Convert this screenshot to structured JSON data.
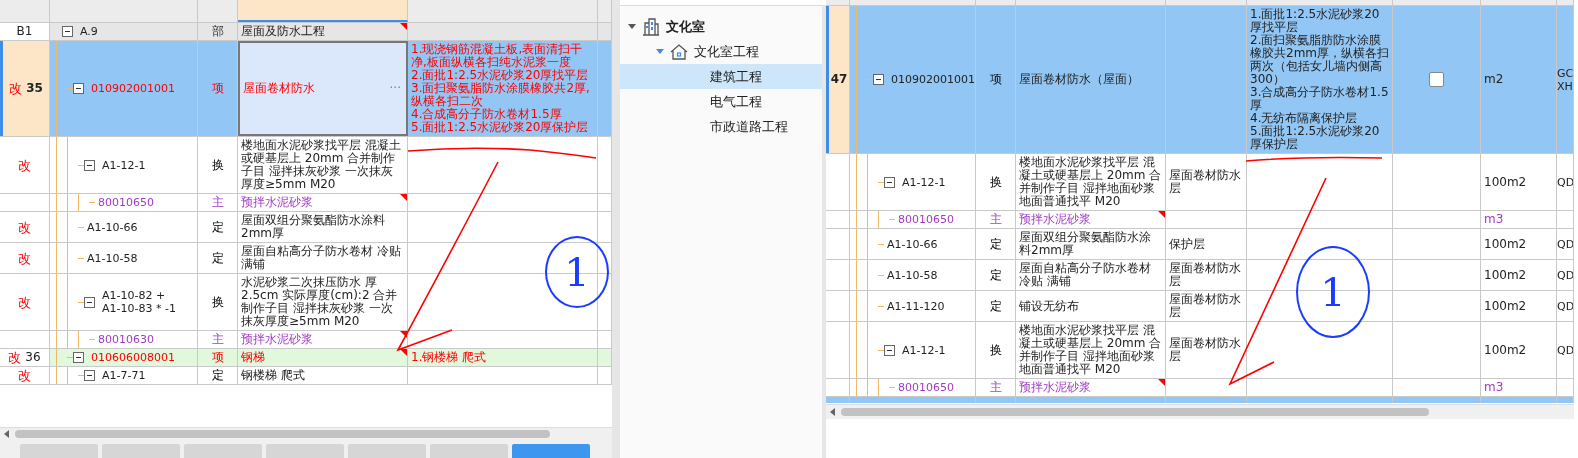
{
  "left_table": {
    "rows": [
      {
        "index": "B1",
        "code": "A.9",
        "type": "部",
        "kind": "section",
        "name": "屋面及防水工程",
        "flagged": true,
        "selected": false,
        "expanded": true,
        "children": [
          {
            "mark": "改",
            "index": "35",
            "code": "010902001001",
            "type": "项",
            "kind": "item",
            "color": "#ff0000",
            "name": "屋面卷材防水",
            "name_button": "···",
            "features": "1.现浇钢筋混凝土板,表面清扫干净,板面纵横各扫纯水泥浆一度\n2.面批1:2.5水泥砂浆20厚找平层\n3.面扫聚氨脂防水涂膜橡胶共2厚,纵横各扫二次\n4.合成高分子防水卷材1.5厚\n5.面批1:2.5水泥砂浆20厚保护层",
            "flagged": false,
            "selected": true,
            "expanded": true,
            "children": [
              {
                "mark": "改",
                "code": "A1-12-1",
                "type": "换",
                "kind": "quota",
                "name": "楼地面水泥砂浆找平层 混凝土或硬基层上 20mm 合并制作子目 湿拌抹灰砂浆 一次抹灰厚度≥5mm M20",
                "flagged": false,
                "selected": false,
                "expanded": true,
                "children": [
                  {
                    "code": "80010650",
                    "type": "主",
                    "kind": "material",
                    "color": "#a23bc4",
                    "name": "预拌水泥砂浆",
                    "flagged": true,
                    "selected": false
                  }
                ]
              },
              {
                "mark": "改",
                "code": "A1-10-66",
                "type": "定",
                "kind": "quota",
                "name": "屋面双组分聚氨酯防水涂料 2mm厚",
                "flagged": false,
                "selected": false
              },
              {
                "mark": "改",
                "code": "A1-10-58",
                "type": "定",
                "kind": "quota",
                "name": "屋面自粘高分子防水卷材 冷贴满铺",
                "flagged": false,
                "selected": false
              },
              {
                "mark": "改",
                "code": "A1-10-82 +\nA1-10-83 * -1",
                "type": "换",
                "kind": "quota",
                "name": "水泥砂浆二次抹压防水 厚2.5cm 实际厚度(cm):2 合并制作子目 湿拌抹灰砂浆 一次抹灰厚度≥5mm M20",
                "flagged": false,
                "selected": false,
                "expanded": true,
                "children": [
                  {
                    "code": "80010630",
                    "type": "主",
                    "kind": "material",
                    "color": "#a23bc4",
                    "name": "预拌水泥砂浆",
                    "flagged": true,
                    "selected": false
                  }
                ]
              }
            ]
          },
          {
            "mark": "改",
            "index": "36",
            "code": "010606008001",
            "type": "项",
            "kind": "item",
            "color": "#ff0000",
            "name": "钢梯",
            "features": "1.钢楼梯 爬式",
            "flagged": true,
            "selected": false,
            "expanded": true,
            "children": [
              {
                "mark": "改",
                "code": "A1-7-71",
                "type": "定",
                "kind": "quota",
                "name": "钢楼梯 爬式",
                "flagged": false,
                "selected": false,
                "expanded": true
              }
            ]
          }
        ]
      }
    ],
    "bottom_tabs": [
      {
        "selected": false
      },
      {
        "selected": false
      },
      {
        "selected": false
      },
      {
        "selected": false
      },
      {
        "selected": false
      },
      {
        "selected": false
      },
      {
        "selected": true
      }
    ],
    "annotations": [
      {
        "kind": "underline"
      },
      {
        "kind": "arrow"
      },
      {
        "kind": "circled",
        "label": "1"
      }
    ]
  },
  "project_tree": [
    {
      "label": "文化室",
      "kind": "project",
      "expanded": true,
      "selected": false,
      "children": [
        {
          "label": "文化室工程",
          "kind": "single",
          "expanded": true,
          "selected": false,
          "children": [
            {
              "label": "建筑工程",
              "kind": "unit",
              "selected": true
            },
            {
              "label": "电气工程",
              "kind": "unit",
              "selected": false
            },
            {
              "label": "市政道路工程",
              "kind": "unit",
              "selected": false
            }
          ]
        }
      ]
    }
  ],
  "right_table": {
    "rows": [
      {
        "index": "47",
        "code": "010902001001",
        "type": "项",
        "kind": "item",
        "name": "屋面卷材防水（屋面）",
        "features": "1.面批1:2.5水泥砂浆20厚找平层\n2.面扫聚氨脂肪防水涂膜橡胶共2mm厚，纵横各扫两次（包括女儿墙内侧高300）\n3.合成高分子防水卷材1.5厚\n4.无纺布隔离保护层\n5.面批1:2.5水泥砂浆20厚保护层",
        "checked": false,
        "unit": "m2",
        "column_9": "GC\nXH",
        "flagged": false,
        "selected": true,
        "expanded": true,
        "children": [
          {
            "code": "A1-12-1",
            "type": "换",
            "kind": "quota",
            "name": "楼地面水泥砂浆找平层 混凝土或硬基层上 20mm 合并制作子目 湿拌地面砂浆地面普通找平 M20",
            "column_5": "屋面卷材防水层",
            "unit": "100m2",
            "column_9": "QD",
            "flagged": false,
            "selected": false,
            "expanded": true,
            "children": [
              {
                "code": "80010650",
                "type": "主",
                "kind": "material",
                "color": "#a23bc4",
                "name": "预拌水泥砂浆",
                "unit": "m3",
                "flagged": true,
                "selected": false
              }
            ]
          },
          {
            "code": "A1-10-66",
            "type": "定",
            "kind": "quota",
            "name": "屋面双组分聚氨酯防水涂料2mm厚",
            "column_5": "保护层",
            "unit": "100m2",
            "column_9": "QD",
            "flagged": false,
            "selected": false
          },
          {
            "code": "A1-10-58",
            "type": "定",
            "kind": "quota",
            "name": "屋面自粘高分子防水卷材冷贴 满铺",
            "column_5": "屋面卷材防水层",
            "unit": "100m2",
            "column_9": "QD",
            "flagged": false,
            "selected": false
          },
          {
            "code": "A1-11-120",
            "type": "定",
            "kind": "quota",
            "name": "铺设无纺布",
            "column_5": "屋面卷材防水层",
            "unit": "100m2",
            "column_9": "QD",
            "flagged": false,
            "selected": false
          },
          {
            "code": "A1-12-1",
            "type": "换",
            "kind": "quota",
            "name": "楼地面水泥砂浆找平层 混凝土或硬基层上 20mm 合并制作子目 湿拌地面砂浆地面普通找平 M20",
            "column_5": "屋面卷材防水层",
            "unit": "100m2",
            "column_9": "QD",
            "flagged": false,
            "selected": false,
            "expanded": true,
            "children": [
              {
                "code": "80010650",
                "type": "主",
                "kind": "material",
                "color": "#a23bc4",
                "name": "预拌水泥砂浆",
                "unit": "m3",
                "flagged": true,
                "selected": false
              }
            ]
          }
        ]
      }
    ],
    "annotations": [
      {
        "kind": "underline"
      },
      {
        "kind": "arrow"
      },
      {
        "kind": "circled",
        "label": "1"
      }
    ]
  }
}
